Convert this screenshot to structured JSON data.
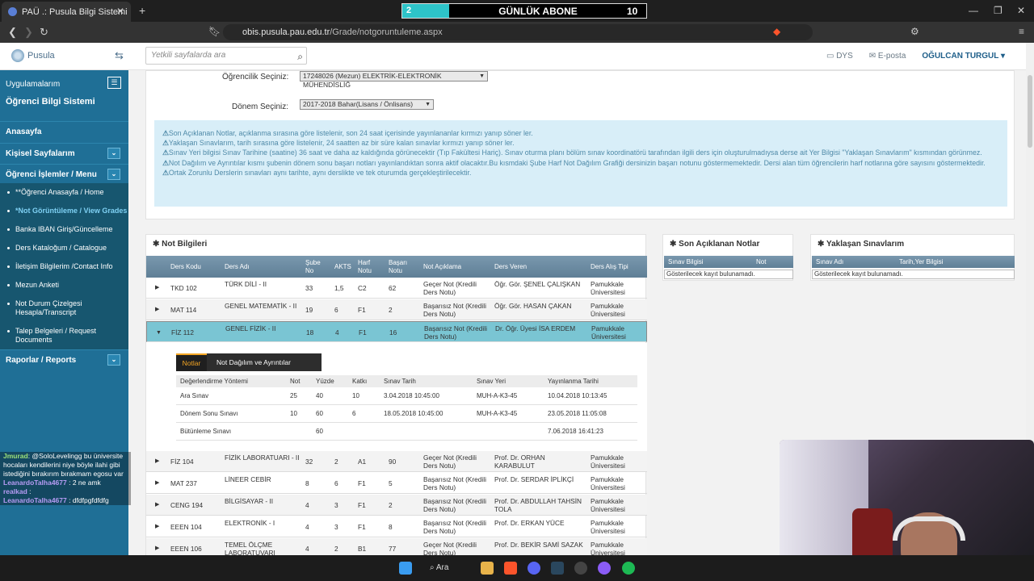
{
  "browser": {
    "tab_title": "PAÜ .: Pusula Bilgi Sistemi",
    "url_host": "obis.pusula.pau.edu.tr",
    "url_path": "/Grade/notgoruntuleme.aspx"
  },
  "overlay": {
    "subscriber_count": "2",
    "subscriber_title": "GÜNLÜK ABONE",
    "subscriber_goal": "10"
  },
  "topbar": {
    "brand": "Pusula",
    "search_placeholder": "Yetkili sayfalarda ara",
    "dys": "DYS",
    "eposta": "E-posta",
    "user": "OĞULCAN TURGUL ▾"
  },
  "sidebar": {
    "apps_label": "Uygulamalarım",
    "system_title": "Öğrenci Bilgi Sistemi",
    "home": "Anasayfa",
    "personal": "Kişisel Sayfalarım",
    "student_ops": "Öğrenci İşlemler / Menu",
    "items": [
      {
        "label": "**Öğrenci Anasayfa / Home"
      },
      {
        "label": "*Not Görüntüleme / View Grades"
      },
      {
        "label": "Banka IBAN Giriş/Güncelleme"
      },
      {
        "label": "Ders Kataloğum / Catalogue"
      },
      {
        "label": "İletişim Bilgilerim /Contact Info"
      },
      {
        "label": "Mezun Anketi"
      },
      {
        "label": "Not Durum Çizelgesi Hesapla/Transcript"
      },
      {
        "label": "Talep Belgeleri / Request Documents"
      }
    ],
    "reports": "Raporlar / Reports"
  },
  "form": {
    "student_label": "Öğrencilik Seçiniz:",
    "student_value": "17248026 (Mezun) ELEKTRİK-ELEKTRONİK MÜHENDİSLİĞ",
    "term_label": "Dönem Seçiniz:",
    "term_value": "2017-2018 Bahar(Lisans / Önlisans)"
  },
  "notice": [
    "Son Açıklanan Notlar, açıklanma sırasına göre listelenir, son 24 saat içerisinde yayınlananlar kırmızı yanıp söner ler.",
    "Yaklaşan Sınavlarım, tarih sırasına göre listelenir, 24 saatten az bir süre kalan sınavlar kırmızı yanıp söner ler.",
    "Sınav Yeri bilgisi Sınav Tarihine (saatine) 36 saat ve daha az kaldığında görünecektir (Tıp Fakültesi Hariç). Sınav oturma planı bölüm sınav koordinatörü tarafından ilgili ders için oluşturulmadıysa derse ait Yer Bilgisi \"Yaklaşan Sınavlarım\" kısmından görünmez.",
    "Not Dağılım ve Ayrıntılar kısmı şubenin dönem sonu başarı notları yayınlandıktan sonra aktif olacaktır.Bu kısmdaki Şube Harf Not Dağılım Grafiği dersinizin başarı notunu göstermemektedir. Dersi alan tüm öğrencilerin harf notlarına göre sayısını göstermektedir.",
    "Ortak Zorunlu Derslerin sınavları aynı tarihte, aynı derslikte ve tek oturumda gerçekleştirilecektir."
  ],
  "grades": {
    "title": "Not Bilgileri",
    "headers": [
      "Ders Kodu",
      "Ders Adı",
      "Şube No",
      "AKTS",
      "Harf Notu",
      "Başarı Notu",
      "Not Açıklama",
      "Ders Veren",
      "Ders Alış Tipi"
    ],
    "rows": [
      {
        "code": "TKD 102",
        "name": "TÜRK DİLİ - II",
        "sube": "33",
        "akts": "1,5",
        "harf": "C2",
        "basari": "62",
        "aciklama": "Geçer Not (Kredili Ders Notu)",
        "veren": "Öğr. Gör. ŞENEL ÇALIŞKAN",
        "tip": "Pamukkale Üniversitesi"
      },
      {
        "code": "MAT 114",
        "name": "GENEL MATEMATİK - II",
        "sube": "19",
        "akts": "6",
        "harf": "F1",
        "basari": "2",
        "aciklama": "Başarısız Not (Kredili Ders Notu)",
        "veren": "Öğr. Gör. HASAN ÇAKAN",
        "tip": "Pamukkale Üniversitesi"
      },
      {
        "code": "FİZ 112",
        "name": "GENEL FİZİK - II",
        "sube": "18",
        "akts": "4",
        "harf": "F1",
        "basari": "16",
        "aciklama": "Başarısız Not (Kredili Ders Notu)",
        "veren": "Dr. Öğr. Üyesi İSA ERDEM",
        "tip": "Pamukkale Üniversitesi"
      },
      {
        "code": "FİZ 104",
        "name": "FİZİK LABORATUARI - II",
        "sube": "32",
        "akts": "2",
        "harf": "A1",
        "basari": "90",
        "aciklama": "Geçer Not (Kredili Ders Notu)",
        "veren": "Prof. Dr. ORHAN KARABULUT",
        "tip": "Pamukkale Üniversitesi"
      },
      {
        "code": "MAT 237",
        "name": "LİNEER CEBİR",
        "sube": "8",
        "akts": "6",
        "harf": "F1",
        "basari": "5",
        "aciklama": "Başarısız Not (Kredili Ders Notu)",
        "veren": "Prof. Dr. SERDAR İPLİKÇİ",
        "tip": "Pamukkale Üniversitesi"
      },
      {
        "code": "CENG 194",
        "name": "BİLGİSAYAR - II",
        "sube": "4",
        "akts": "3",
        "harf": "F1",
        "basari": "2",
        "aciklama": "Başarısız Not (Kredili Ders Notu)",
        "veren": "Prof. Dr. ABDULLAH TAHSİN TOLA",
        "tip": "Pamukkale Üniversitesi"
      },
      {
        "code": "EEEN 104",
        "name": "ELEKTRONİK - I",
        "sube": "4",
        "akts": "3",
        "harf": "F1",
        "basari": "8",
        "aciklama": "Başarısız Not (Kredili Ders Notu)",
        "veren": "Prof. Dr. ERKAN YÜCE",
        "tip": "Pamukkale Üniversitesi"
      },
      {
        "code": "EEEN 106",
        "name": "TEMEL ÖLÇME LABORATUVARI",
        "sube": "4",
        "akts": "2",
        "harf": "B1",
        "basari": "77",
        "aciklama": "Geçer Not (Kredili Ders Notu)",
        "veren": "Prof. Dr. BEKİR SAMİ SAZAK",
        "tip": "Pamukkale Üniversitesi"
      }
    ],
    "detail": {
      "tab_notes": "Notlar",
      "tab_dist": "Not Dağılım ve Ayrıntılar",
      "headers": [
        "Değerlendirme Yöntemi",
        "Not",
        "Yüzde",
        "Katkı",
        "Sınav Tarih",
        "Sınav Yeri",
        "Yayınlanma Tarihi"
      ],
      "rows": [
        [
          "Ara Sınav",
          "25",
          "40",
          "10",
          "3.04.2018 10:45:00",
          "MUH-A-K3-45",
          "10.04.2018 10:13:45"
        ],
        [
          "Dönem Sonu Sınavı",
          "10",
          "60",
          "6",
          "18.05.2018 10:45:00",
          "MUH-A-K3-45",
          "23.05.2018 11:05:08"
        ],
        [
          "Bütünleme Sınavı",
          "",
          "60",
          "",
          "",
          "",
          "7.06.2018 16:41:23"
        ]
      ]
    }
  },
  "son_notlar": {
    "title": "Son Açıklanan Notlar",
    "headers": [
      "Sınav Bilgisi",
      "Not"
    ],
    "empty": "Gösterilecek kayıt bulunamadı."
  },
  "yaklasan": {
    "title": "Yaklaşan Sınavlarım",
    "headers": [
      "Sınav Adı",
      "Tarih,Yer Bilgisi"
    ],
    "empty": "Gösterilecek kayıt bulunamadı."
  },
  "chat": [
    {
      "user": "Jmurad",
      "text": "@SoloLevelingg bu üniversite hocaları kendilerini niye böyle ilahi gibi istediğini bırakırım bırakmam egosu var"
    },
    {
      "user": "LeanardoTalha4677",
      "text": "2 ne amk"
    },
    {
      "user": "realkad",
      "text": ""
    },
    {
      "user": "LeanardoTalha4677",
      "text": "dfdfpgfdfdfg"
    }
  ],
  "taskbar": {
    "search": "Ara"
  }
}
